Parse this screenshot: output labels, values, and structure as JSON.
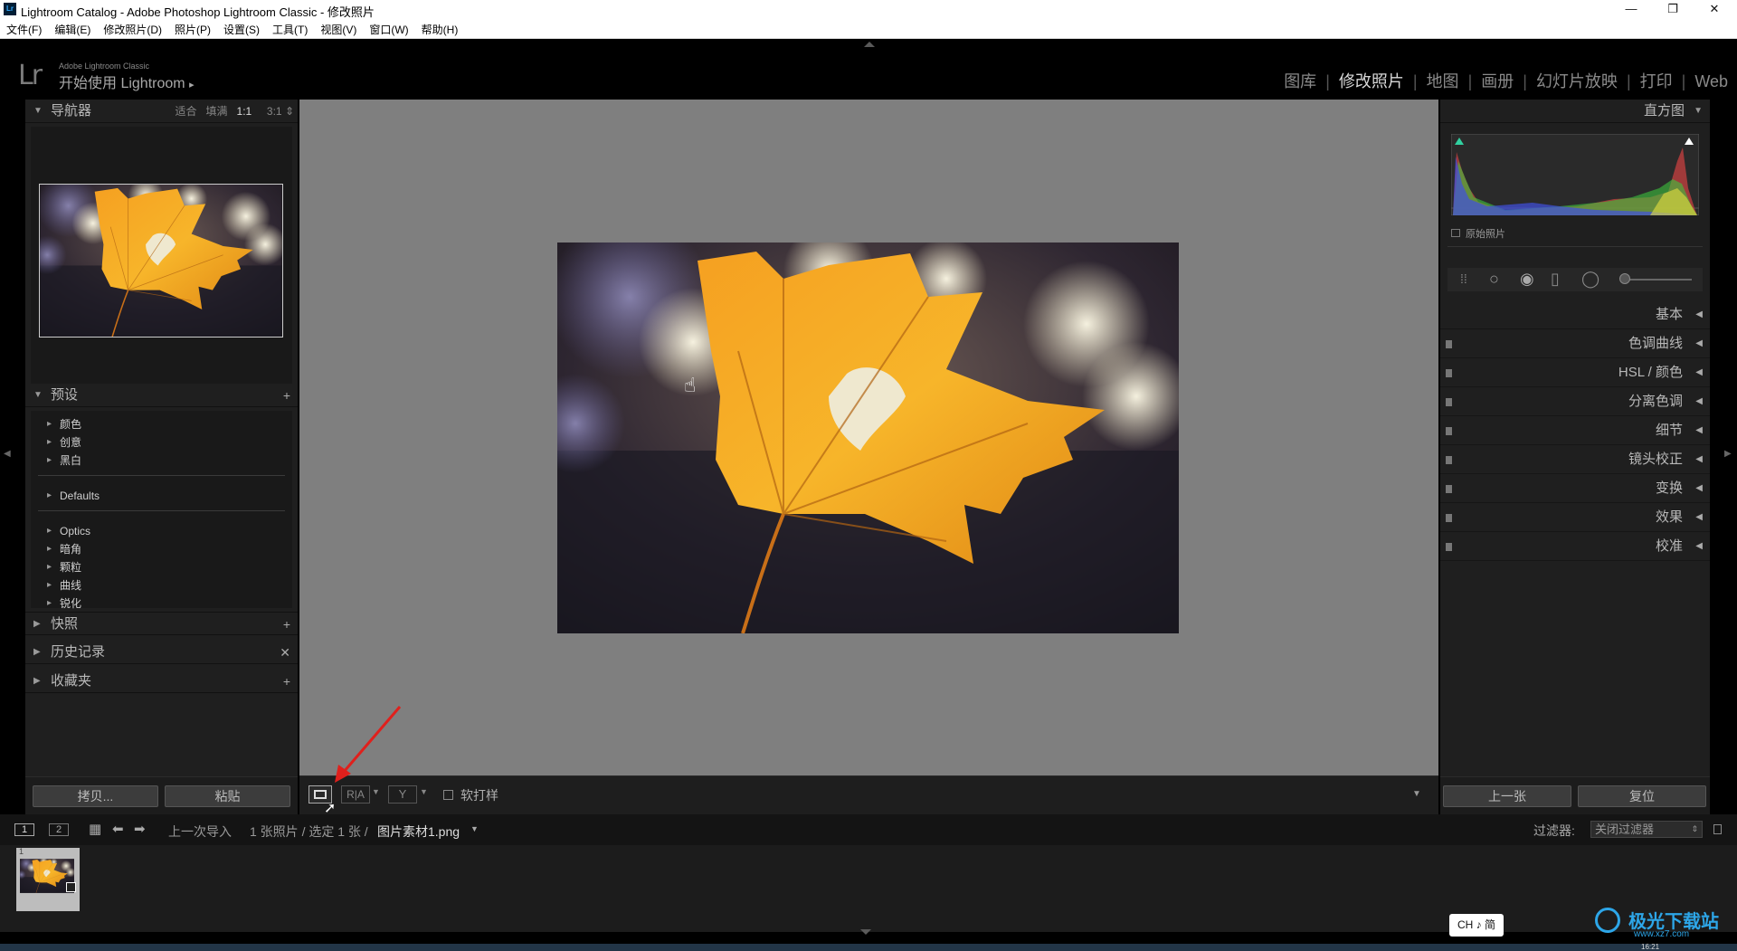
{
  "window": {
    "title": "Lightroom Catalog - Adobe Photoshop Lightroom Classic - 修改照片",
    "logo": "Lr",
    "minimize": "—",
    "maximize": "❐",
    "close": "✕"
  },
  "menu": [
    "文件(F)",
    "编辑(E)",
    "修改照片(D)",
    "照片(P)",
    "设置(S)",
    "工具(T)",
    "视图(V)",
    "窗口(W)",
    "帮助(H)"
  ],
  "identity": {
    "lr": "Lr",
    "app": "Adobe Lightroom Classic",
    "getting_started": "开始使用 Lightroom",
    "arrow": "▸"
  },
  "modules": [
    "图库",
    "修改照片",
    "地图",
    "画册",
    "幻灯片放映",
    "打印",
    "Web"
  ],
  "active_module": "修改照片",
  "navigator": {
    "title": "导航器",
    "zooms": [
      "适合",
      "填满",
      "1:1",
      "3:1"
    ],
    "active_zoom": "1:1"
  },
  "presets": {
    "title": "预设",
    "groups1": [
      "颜色",
      "创意",
      "黑白"
    ],
    "groups2": [
      "Defaults"
    ],
    "groups3": [
      "Optics",
      "暗角",
      "颗粒",
      "曲线",
      "锐化"
    ]
  },
  "snapshots": {
    "title": "快照",
    "action": "+"
  },
  "history": {
    "title": "历史记录",
    "action": "✕"
  },
  "collections": {
    "title": "收藏夹",
    "action": "+"
  },
  "left_buttons": {
    "copy": "拷贝...",
    "paste": "粘贴"
  },
  "histogram": {
    "title": "直方图",
    "original": "原始照片"
  },
  "right_panels": [
    "基本",
    "色调曲线",
    "HSL / 颜色",
    "分离色调",
    "细节",
    "镜头校正",
    "变换",
    "效果",
    "校准"
  ],
  "right_buttons": {
    "prev": "上一张",
    "reset": "复位"
  },
  "toolbar": {
    "soft_proof": "软打样"
  },
  "filmstrip": {
    "pages": [
      "1",
      "2"
    ],
    "source": "上一次导入",
    "count": "1 张照片 / 选定 1 张 /",
    "filename": "图片素材1.png",
    "filter_label": "过滤器:",
    "filter_value": "关闭过滤器",
    "thumb_index": "1"
  },
  "ime": "CH ♪ 简",
  "watermark": "极光下载站",
  "watermark_url": "www.xz7.com",
  "clock": "16:21",
  "colors": {
    "panel": "#1f1f1f",
    "center": "#7f7f7f",
    "accent": "#31a8ff",
    "arrow": "#e0201c"
  }
}
